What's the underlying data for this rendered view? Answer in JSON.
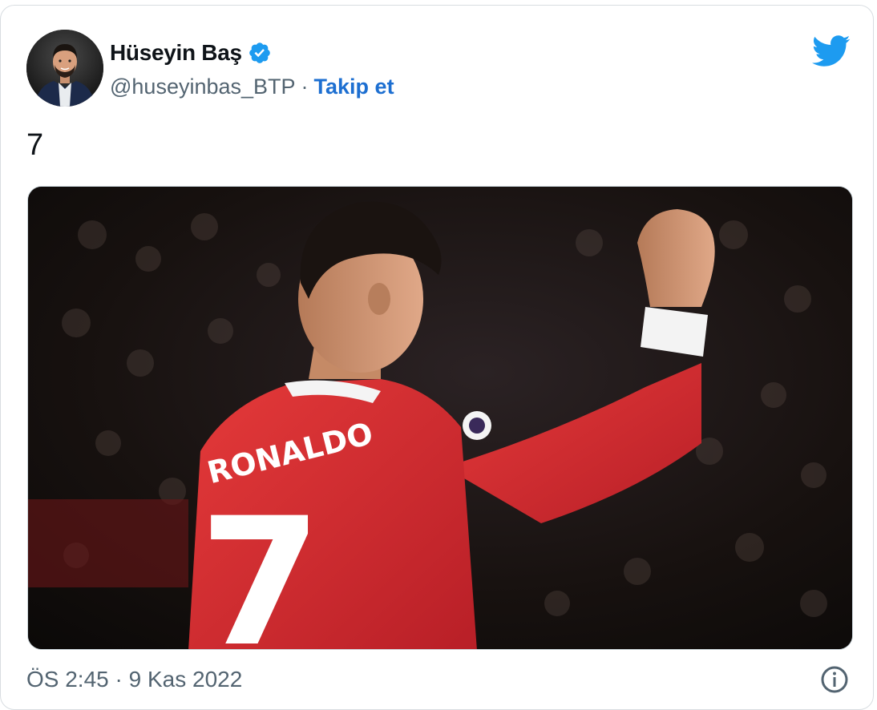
{
  "tweet": {
    "author": {
      "name": "Hüseyin Baş",
      "handle": "@huseyinbas_BTP",
      "separator": "·",
      "follow_label": "Takip et",
      "verified": true
    },
    "text": "7",
    "media": {
      "jersey_name": "RONALDO",
      "jersey_number": "7"
    },
    "timestamp": "ÖS 2:45 · 9 Kas 2022"
  },
  "colors": {
    "brand": "#1d9bf0",
    "follow_link": "#1d6fd1",
    "secondary_text": "#536471",
    "jersey_red": "#d42a2f"
  },
  "icons": {
    "verified": "verified-badge-icon",
    "logo": "twitter-bird-icon",
    "info": "info-icon"
  }
}
